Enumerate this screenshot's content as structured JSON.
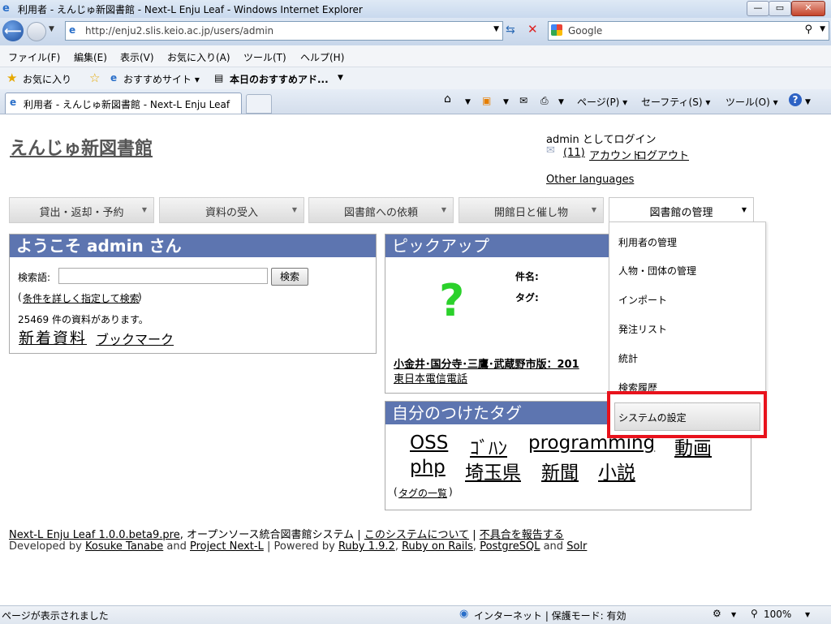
{
  "browser": {
    "window_title": "利用者 - えんじゅ新図書館 - Next-L Enju Leaf - Windows Internet Explorer",
    "window_buttons": {
      "minimize": "—",
      "maximize": "▭",
      "close": "✕"
    },
    "address": "http://enju2.slis.keio.ac.jp/users/admin",
    "search_placeholder": "Google",
    "menu": [
      "ファイル(F)",
      "編集(E)",
      "表示(V)",
      "お気に入り(A)",
      "ツール(T)",
      "ヘルプ(H)"
    ],
    "favorites": {
      "label": "お気に入り",
      "items": [
        "おすすめサイト ▾",
        "本日のおすすめアド..."
      ]
    },
    "tab_title": "利用者 - えんじゅ新図書館 - Next-L Enju Leaf",
    "commands": {
      "page": "ページ(P) ▾",
      "safety": "セーフティ(S) ▾",
      "tools": "ツール(O) ▾"
    },
    "status_text": "ページが表示されました",
    "zone_text": "インターネット | 保護モード: 有効",
    "zoom": "100%"
  },
  "site": {
    "title": "えんじゅ新図書館",
    "login_as": "admin としてログイン",
    "messages": "(11)",
    "account": "アカウント",
    "logout": "ログアウト",
    "other_languages": "Other languages"
  },
  "nav_menu": [
    {
      "label": "貸出・返却・予約"
    },
    {
      "label": "資料の受入"
    },
    {
      "label": "図書館への依頼"
    },
    {
      "label": "開館日と催し物"
    },
    {
      "label": "図書館の管理"
    }
  ],
  "dropdown": {
    "items": [
      "利用者の管理",
      "人物・団体の管理",
      "インポート",
      "発注リスト",
      "統計",
      "検索履歴"
    ],
    "highlighted": "システムの設定",
    "highlight_color": "#e8121c"
  },
  "welcome": {
    "heading": "ようこそ admin さん",
    "search_label": "検索語:",
    "search_value": "",
    "search_button": "検索",
    "advanced_prefix": "(",
    "advanced_link": "条件を詳しく指定して検索",
    "advanced_suffix": ")",
    "count_text": "25469 件の資料があります。",
    "new_items": "新着資料",
    "bookmarks": "ブックマーク"
  },
  "pickup": {
    "heading": "ピックアップ",
    "image_glyph": "?",
    "subject_label": "件名:",
    "tag_label": "タグ:",
    "book_title": "小金井･国分寺･三鷹･武蔵野市版：201",
    "publisher": "東日本電信電話"
  },
  "tags": {
    "heading": "自分のつけたタグ",
    "items": [
      "OSS",
      "ｺﾞﾊﾝ",
      "programming",
      "動画",
      "php",
      "埼玉県",
      "新聞",
      "小説"
    ],
    "list_prefix": "(",
    "list_link": "タグの一覧",
    "list_suffix": ")"
  },
  "footer": {
    "product": "Next-L Enju Leaf 1.0.0.beta9.pre",
    "desc": ", オープンソース統合図書館システム |",
    "about": "このシステムについて",
    "sep": "|",
    "report": "不具合を報告する",
    "dev_by": "Developed by",
    "dev_name": "Kosuke Tanabe",
    "and1": "and",
    "project": "Project Next-L",
    "powered": "| Powered by",
    "ruby": "Ruby 1.9.2",
    "comma1": ",",
    "rails": "Ruby on Rails",
    "comma2": ",",
    "pg": "PostgreSQL",
    "and2": "and",
    "solr": "Solr"
  },
  "colors": {
    "panel_header": "#5d75b0",
    "pickup_placeholder": "#2bd12b"
  }
}
